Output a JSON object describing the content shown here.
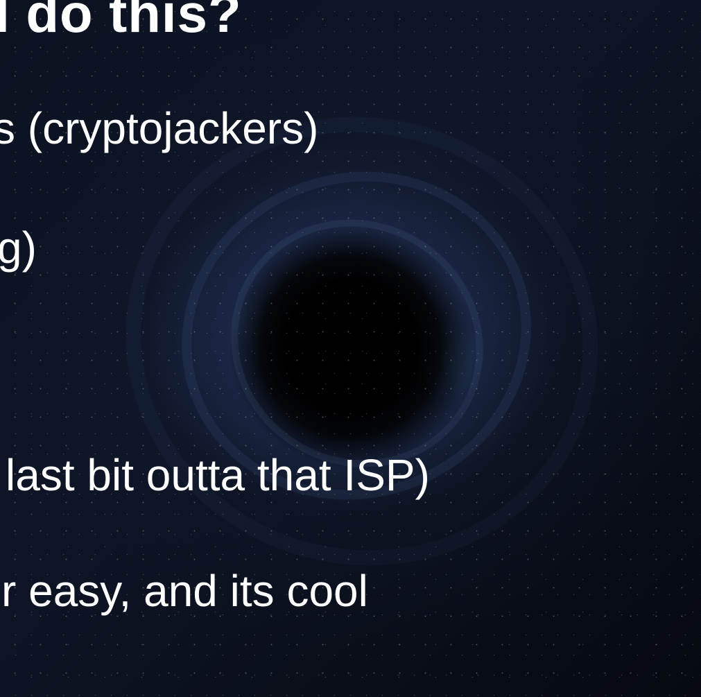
{
  "slide": {
    "title": "I do this?",
    "bullets": [
      "s (cryptojackers)",
      "g)",
      " last bit outta that ISP)",
      "r easy, and its cool"
    ]
  },
  "colors": {
    "text": "#ffffff",
    "background": "#0b1220",
    "core": "#000000"
  }
}
